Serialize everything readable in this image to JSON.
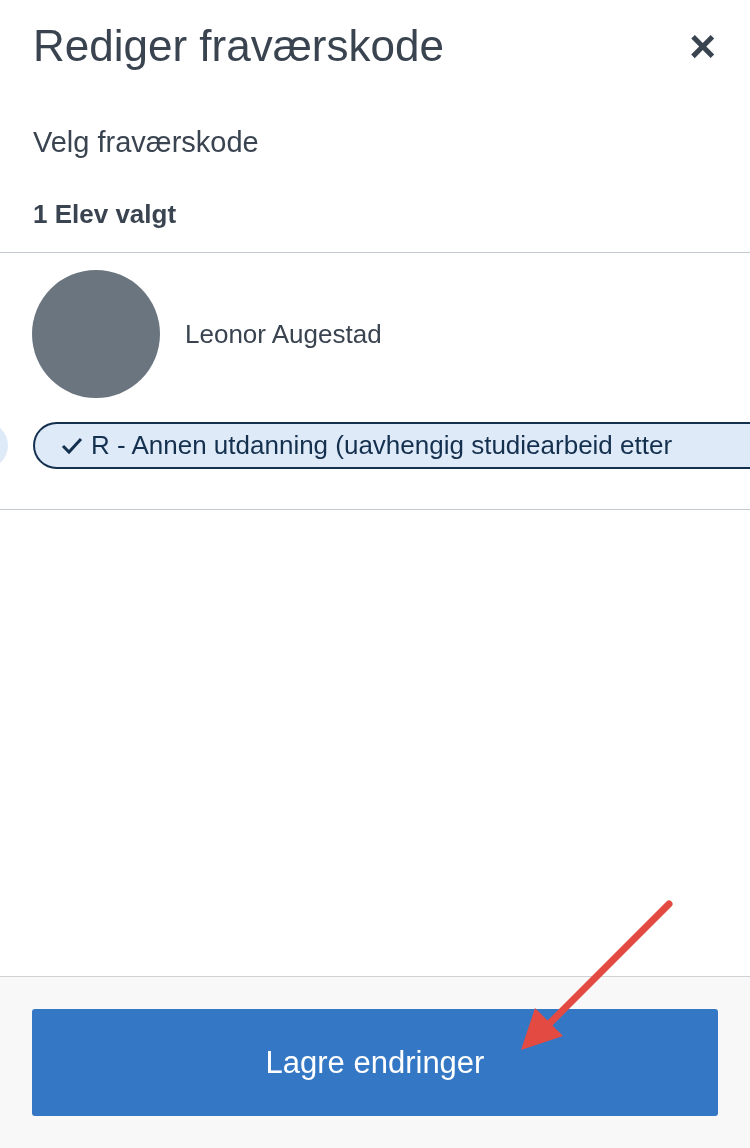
{
  "dialog": {
    "title": "Rediger fraværskode",
    "close_label": "×"
  },
  "section_title": "Velg fraværskode",
  "selection_count": "1 Elev valgt",
  "students": [
    {
      "name": "Leonor Augestad",
      "codes": [
        {
          "label": "R - Annen utdanning (uavhengig studiearbeid etter",
          "selected": true
        }
      ]
    }
  ],
  "save_button": "Lagre endringer"
}
